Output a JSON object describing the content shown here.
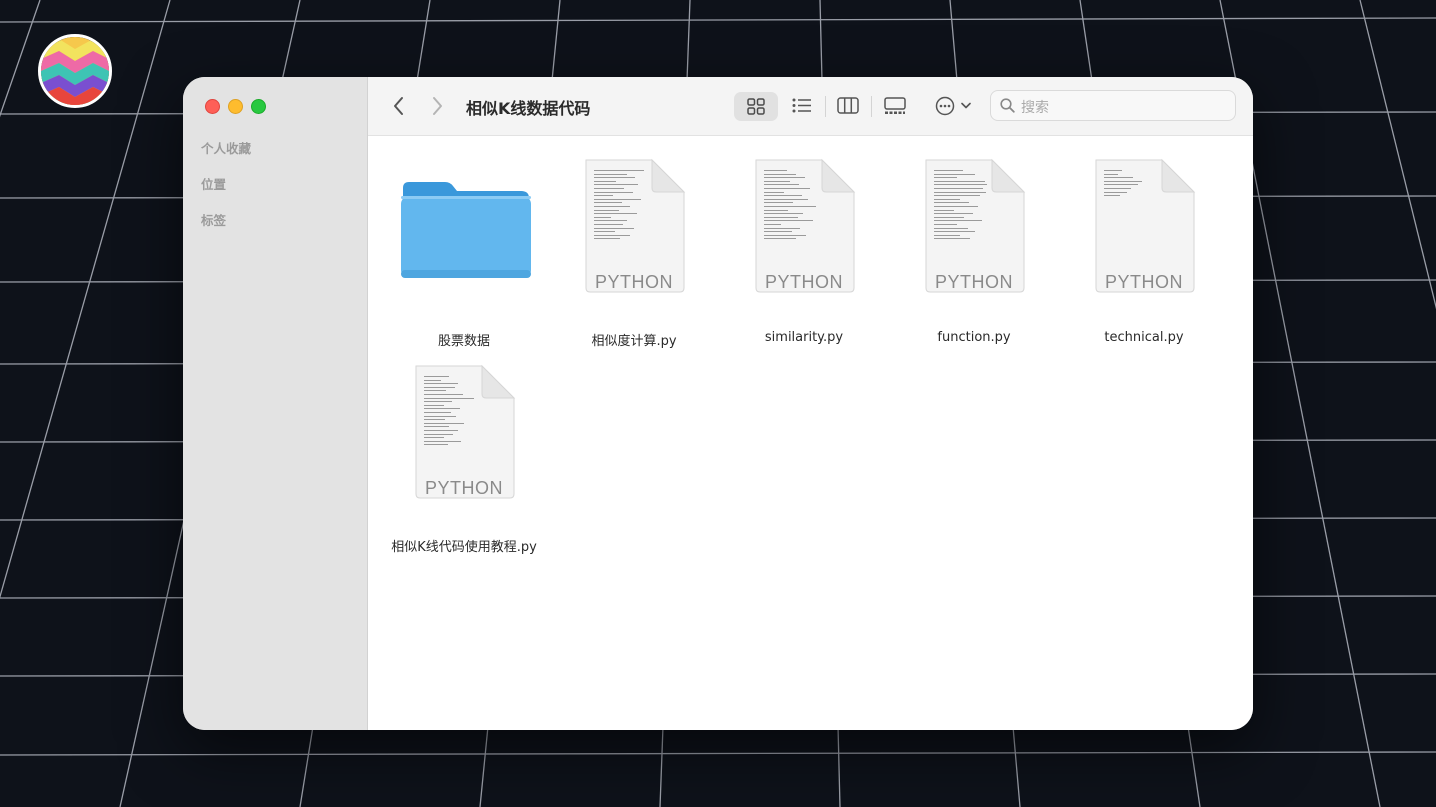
{
  "window": {
    "title": "相似K线数据代码"
  },
  "sidebar": {
    "sections": [
      "个人收藏",
      "位置",
      "标签"
    ]
  },
  "toolbar": {
    "view_modes": [
      "icon-view",
      "list-view",
      "column-view",
      "gallery-view"
    ],
    "selected_view": "icon-view",
    "search_placeholder": "搜索"
  },
  "files": [
    {
      "name": "股票数据",
      "kind": "folder"
    },
    {
      "name": "相似度计算.py",
      "kind": "python",
      "badge": "PYTHON"
    },
    {
      "name": "similarity.py",
      "kind": "python",
      "badge": "PYTHON"
    },
    {
      "name": "function.py",
      "kind": "python",
      "badge": "PYTHON"
    },
    {
      "name": "technical.py",
      "kind": "python",
      "badge": "PYTHON"
    },
    {
      "name": "相似K线代码使用教程.py",
      "kind": "python",
      "badge": "PYTHON"
    }
  ],
  "colors": {
    "desktop_bg": "#0e121a",
    "folder_blue": "#62b7ee",
    "close": "#fe5f57",
    "minimize": "#febc2e",
    "maximize": "#28c840"
  }
}
